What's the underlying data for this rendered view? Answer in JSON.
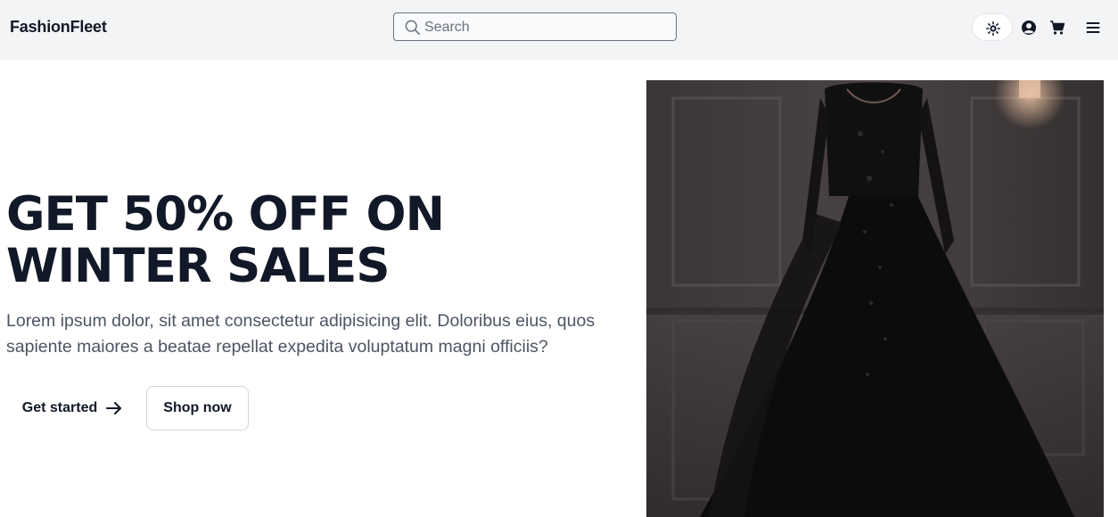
{
  "navbar": {
    "brand": "FashionFleet",
    "search": {
      "placeholder": "Search",
      "value": ""
    },
    "icons": [
      "sun-icon",
      "user-circle-icon",
      "cart-icon",
      "menu-icon"
    ]
  },
  "hero": {
    "title_line1": "GET 50% OFF ON",
    "title_line2": "WINTER SALES",
    "description": "Lorem ipsum dolor, sit amet consectetur adipisicing elit. Doloribus eius, quos sapiente maiores a beatae repellat expedita voluptatum magni officiis?",
    "primary_button": "Get started",
    "secondary_button": "Shop now",
    "image": "black-lace-gown-photo"
  },
  "colors": {
    "navbar_bg": "#f3f4f6",
    "text_dark": "#111827",
    "text_muted": "#4b5563",
    "border": "#d1d5db"
  }
}
